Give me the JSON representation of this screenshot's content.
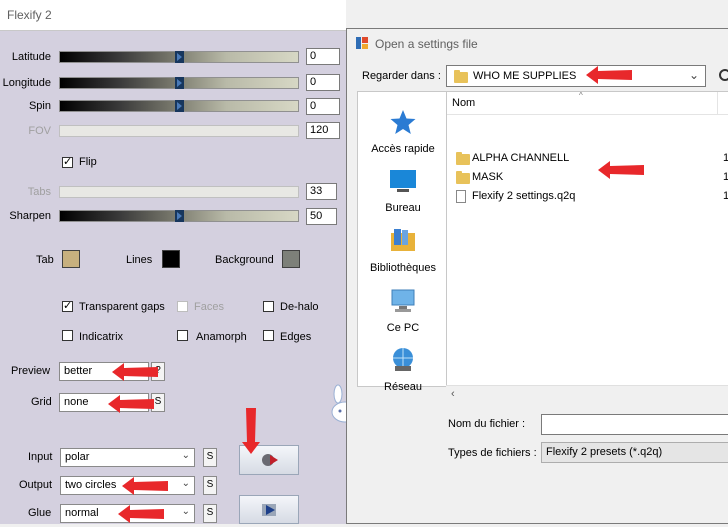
{
  "flexify": {
    "title": "Flexify 2",
    "sliders": [
      {
        "label": "Latitude",
        "value": "0",
        "enabled": true,
        "level": 0.49
      },
      {
        "label": "Longitude",
        "value": "0",
        "enabled": true,
        "level": 0.49
      },
      {
        "label": "Spin",
        "value": "0",
        "enabled": true,
        "level": 0.49
      },
      {
        "label": "FOV",
        "value": "120",
        "enabled": false,
        "level": 0.0
      },
      {
        "label": "Tabs",
        "value": "33",
        "enabled": false,
        "level": 0.0
      },
      {
        "label": "Sharpen",
        "value": "50",
        "enabled": true,
        "level": 0.49
      }
    ],
    "flip_label": "Flip",
    "colors": {
      "tab_label": "Tab",
      "tab_color": "#c7b07e",
      "lines_label": "Lines",
      "lines_color": "#000000",
      "background_label": "Background",
      "background_color": "#7d8079"
    },
    "options": {
      "transparent_gaps": "Transparent gaps",
      "faces": "Faces",
      "de_halo": "De-halo",
      "indicatrix": "Indicatrix",
      "anamorph": "Anamorph",
      "edges": "Edges"
    },
    "preview": {
      "label": "Preview",
      "value": "better"
    },
    "grid": {
      "label": "Grid",
      "value": "none"
    },
    "input": {
      "label": "Input",
      "value": "polar"
    },
    "output": {
      "label": "Output",
      "value": "two circles"
    },
    "glue": {
      "label": "Glue",
      "value": "normal"
    },
    "s_label": "S",
    "q_label": "?"
  },
  "dialog": {
    "title": "Open a settings file",
    "look_in_label": "Regarder dans :",
    "look_in_value": "WHO ME SUPPLIES",
    "places": [
      "Accès rapide",
      "Bureau",
      "Bibliothèques",
      "Ce PC",
      "Réseau"
    ],
    "column_name": "Nom",
    "files": [
      {
        "name": "ALPHA CHANNELL",
        "type": "folder"
      },
      {
        "name": "MASK",
        "type": "folder"
      },
      {
        "name": "Flexify 2 settings.q2q",
        "type": "file"
      }
    ],
    "truncated_col": [
      "1",
      "1",
      "1"
    ],
    "file_name_label": "Nom du fichier :",
    "file_name_value": "",
    "file_type_label": "Types de fichiers :",
    "file_type_value": "Flexify 2 presets (*.q2q)"
  },
  "accent_arrow_color": "#e8282b"
}
